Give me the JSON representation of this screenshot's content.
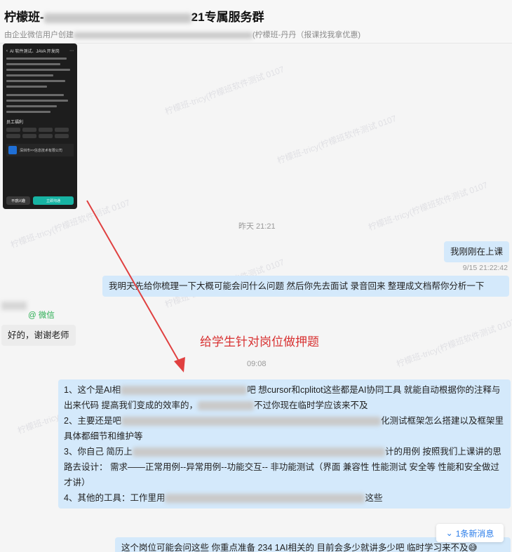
{
  "chat": {
    "title_prefix": "柠檬班-",
    "title_suffix": "21专属服务群",
    "subtitle_prefix": "由企业微信用户创建",
    "subtitle_suffix": "(柠檬班-丹丹（报课找我拿优惠)"
  },
  "watermark": "柠檬班-tricy(柠檬班软件测试 0107",
  "phone_screenshot": {
    "title": "AI 软件测试、JAVA 开发岗",
    "section_benefits": "员工福利",
    "company_name": "深圳市××信息技术有限公司",
    "btn_left": "不感兴趣",
    "btn_right": "立即沟通"
  },
  "messages": {
    "time_yesterday": "昨天 21:21",
    "m1": "我刚刚在上课",
    "m1_time": "9/15 21:22:42",
    "m2": "我明天先给你梳理一下大概可能会问什么问题  然后你先去面试 录音回来 整理成文档帮你分析一下",
    "sender_tag": "@ 微信",
    "reply": "好的，谢谢老师",
    "time_morning": "09:08",
    "long_p1a": "1、这个是AI相",
    "long_p1b": "吧  想cursor和cplitot这些都是AI协同工具  就能自动根据你的注释与出来代码 提高我们变成的效率的，",
    "long_p1c": "不过你现在临时学应该来不及",
    "long_p2a": "2、主要还是吧",
    "long_p2b": "化测试框架怎么搭建以及框架里具体都细节和维护等",
    "long_p3a": "3、你自己 简历上",
    "long_p3b": "计的用例  按照我们上课讲的思路去设计：  需求——正常用例--异常用例--功能交互-- 非功能测试（界面 兼容性 性能测试 安全等  性能和安全做过才讲）",
    "long_p4a": "4、其他的工具：工作里用",
    "long_p4b": "这些",
    "last": "这个岗位可能会问这些  你重点准备 234  1AI相关的  目前会多少就讲多少吧  临时学习来不及😅"
  },
  "annotation": "给学生针对岗位做押题",
  "new_messages": "1条新消息",
  "colors": {
    "bubble_self": "#d4e9fb",
    "bubble_other": "#ececec",
    "annotation": "#d83232",
    "new_msg": "#2b7de9",
    "sender_tag": "#2bae53"
  }
}
